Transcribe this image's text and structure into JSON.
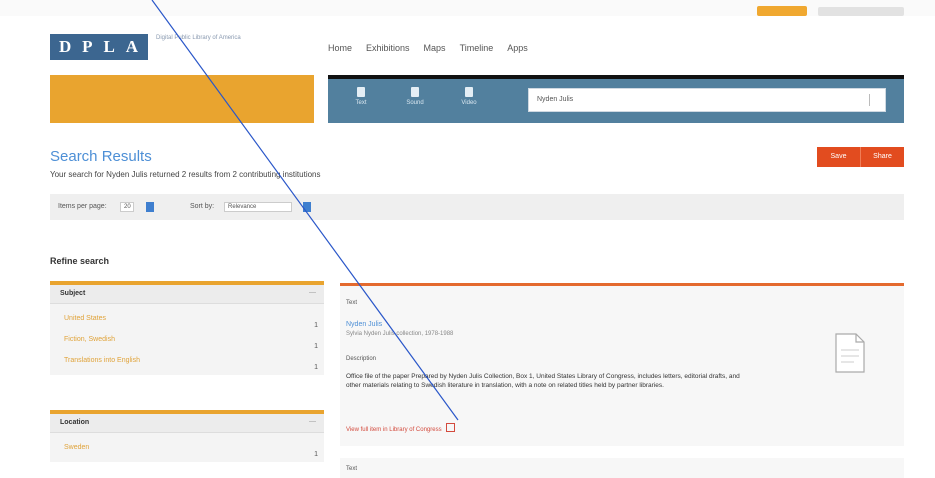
{
  "header": {
    "logo_letters": [
      "D",
      "P",
      "L",
      "A"
    ],
    "tagline": "Digital Public Library of America",
    "nav": [
      "Home",
      "Exhibitions",
      "Maps",
      "Timeline",
      "Apps"
    ],
    "top_buttons": [
      "",
      ""
    ]
  },
  "search": {
    "types": [
      {
        "icon": "image-icon",
        "label": "Text"
      },
      {
        "icon": "sound-icon",
        "label": "Sound"
      },
      {
        "icon": "video-icon",
        "label": "Video"
      }
    ],
    "query": "Nyden Julis"
  },
  "results_header": {
    "title": "Search Results",
    "summary": "Your search for Nyden Julis returned 2 results from 2 contributing institutions",
    "share": [
      "Save",
      "Share"
    ]
  },
  "toolbar": {
    "items_per_page_label": "Items per page:",
    "items_per_page_value": "20",
    "sort_label": "Sort by:",
    "sort_value": "Relevance"
  },
  "refine": {
    "title": "Refine search",
    "facets": [
      {
        "name": "Subject",
        "items": [
          {
            "label": "United States",
            "count": "1"
          },
          {
            "label": "Fiction, Swedish",
            "count": "1"
          },
          {
            "label": "Translations into English",
            "count": "1"
          }
        ]
      },
      {
        "name": "Location",
        "items": [
          {
            "label": "Sweden",
            "count": "1"
          }
        ]
      }
    ]
  },
  "results": [
    {
      "type": "Text",
      "title": "Nyden Julis",
      "subtitle": "Sylvia Nyden Julis collection, 1978-1988",
      "desc_label": "Description",
      "description": "Office file of the paper Prepared by Nyden Julis Collection, Box 1, United States Library of Congress, includes letters, editorial drafts, and other materials relating to Swedish literature in translation, with a note on related titles held by partner libraries.",
      "link": "View full item in Library of Congress",
      "thumb_icon": "document-icon"
    },
    {
      "type": "Text"
    }
  ],
  "colors": {
    "accent_orange": "#e9a42f",
    "nav_blue": "#52809e",
    "link_blue": "#4d8fd6",
    "share_red": "#e24c1f",
    "logo_blue": "#3c6690"
  }
}
